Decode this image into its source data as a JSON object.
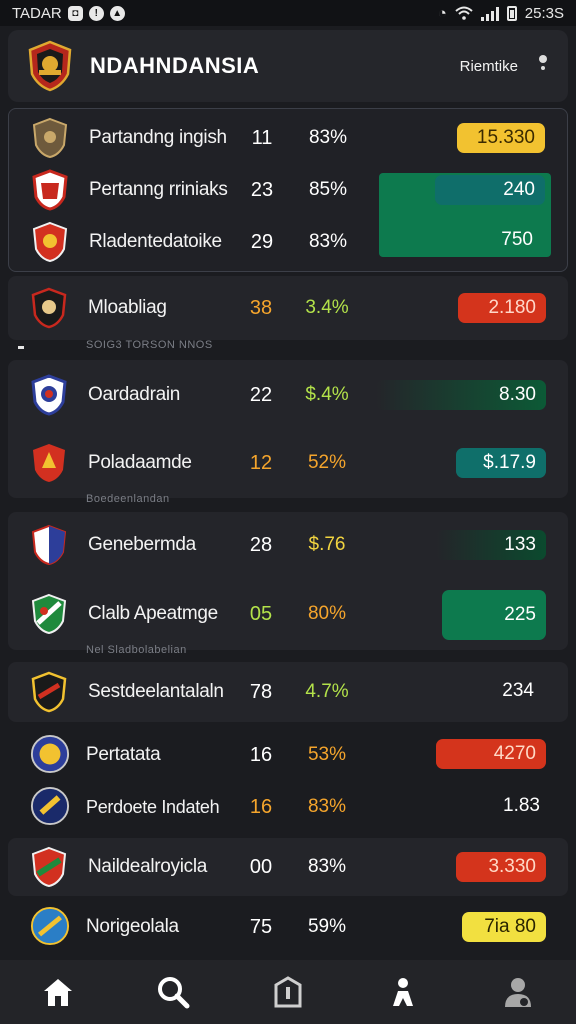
{
  "status_bar": {
    "carrier": "TADAR",
    "time": "25:3S",
    "icons": [
      "camera-icon",
      "alert-icon",
      "location-icon",
      "alarm-icon",
      "wifi-icon",
      "signal-icon",
      "battery-icon"
    ]
  },
  "header": {
    "title": "NDAHNDANSIA",
    "right_link": "Riemtike",
    "menu_icon": "more-icon"
  },
  "colors": {
    "background": "#1b1c20",
    "card": "#24252a",
    "yellow_pill": "#f2c230",
    "green_pill": "#0d7a4e",
    "red_pill": "#d4341c",
    "teal_pill": "#0f6f6a",
    "orange_text": "#f5a52c",
    "lime_text": "#b3e24a"
  },
  "sections": [
    {
      "rows": [
        {
          "team": "Partandng ingish",
          "num": "11",
          "pct": "83%",
          "value": "15.330",
          "crest": "crest-shield-icon"
        },
        {
          "team": "Pertanng rriniaks",
          "num": "23",
          "pct": "85%",
          "value": "240",
          "crest": "crest-shield-icon"
        },
        {
          "team": "Rladentedatoike",
          "num": "29",
          "pct": "83%",
          "value": "750",
          "crest": "crest-shield-icon"
        }
      ]
    },
    {
      "rows": [
        {
          "team": "Mloabliag",
          "num": "38",
          "pct": "3.4%",
          "value": "2.180",
          "crest": "crest-shield-icon"
        }
      ]
    },
    {
      "caption": "SOIG3 TORSON NNOS",
      "rows": [
        {
          "team": "Oardadrain",
          "num": "22",
          "pct": "$.4%",
          "value": "8.30",
          "crest": "crest-shield-icon"
        },
        {
          "team": "Poladaamde",
          "num": "12",
          "pct": "52%",
          "value": "$.17.9",
          "crest": "crest-shield-icon"
        }
      ]
    },
    {
      "caption": "Boedeenlandan",
      "rows": [
        {
          "team": "Genebermda",
          "num": "28",
          "pct": "$.76",
          "value": "133",
          "crest": "crest-shield-icon"
        },
        {
          "team": "Clalb Apeatmge",
          "num": "05",
          "pct": "80%",
          "value": "225",
          "crest": "crest-shield-icon"
        }
      ]
    },
    {
      "caption": "Nel Sladbolabelian",
      "rows": [
        {
          "team": "Sestdeelantalaln",
          "num": "78",
          "pct": "4.7%",
          "value": "234",
          "crest": "crest-shield-icon"
        },
        {
          "team": "Pertatata",
          "num": "16",
          "pct": "53%",
          "value": "4270",
          "crest": "crest-round-icon"
        },
        {
          "team": "Perdoete Indateh",
          "num": "16",
          "pct": "83%",
          "value": "1.83",
          "crest": "crest-round-icon"
        },
        {
          "team": "Naildealroyicla",
          "num": "00",
          "pct": "83%",
          "value": "3.330",
          "crest": "crest-shield-icon"
        },
        {
          "team": "Norigeolala",
          "num": "75",
          "pct": "59%",
          "value": "7ia 80",
          "crest": "crest-round-icon"
        }
      ]
    }
  ],
  "bottom_nav": [
    {
      "name": "home",
      "icon": "home-icon"
    },
    {
      "name": "search",
      "icon": "search-icon"
    },
    {
      "name": "bookmark",
      "icon": "bookmark-icon"
    },
    {
      "name": "player",
      "icon": "player-icon"
    },
    {
      "name": "profile",
      "icon": "profile-icon"
    }
  ]
}
